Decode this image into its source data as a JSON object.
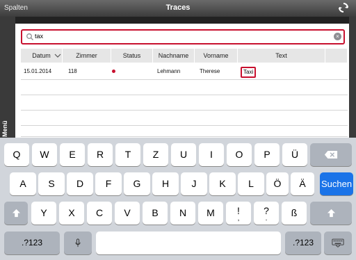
{
  "topbar": {
    "left_label": "Spalten",
    "title": "Traces",
    "right_icon": "refresh-icon"
  },
  "sidebar": {
    "menu_label": "Menü"
  },
  "search": {
    "value": "tax",
    "placeholder": ""
  },
  "table": {
    "columns": [
      "Datum",
      "Zimmer",
      "Status",
      "Nachname",
      "Vorname",
      "Text"
    ],
    "rows": [
      {
        "datum": "15.01.2014",
        "zimmer": "118",
        "status": "red-dot",
        "nachname": "Lehmann",
        "vorname": "Therese",
        "text": "Taxi"
      }
    ]
  },
  "keyboard": {
    "row1": [
      "Q",
      "W",
      "E",
      "R",
      "T",
      "Z",
      "U",
      "I",
      "O",
      "P",
      "Ü"
    ],
    "row2": [
      "A",
      "S",
      "D",
      "F",
      "G",
      "H",
      "J",
      "K",
      "L",
      "Ö",
      "Ä"
    ],
    "row3": [
      "Y",
      "X",
      "C",
      "V",
      "B",
      "N",
      "M",
      "!",
      "?",
      "ß"
    ],
    "row3_sub": [
      ",",
      "."
    ],
    "search_key": "Suchen",
    "numbers_key": ".?123",
    "colors": {
      "accent": "#c8102e",
      "search_key": "#1a73e8"
    }
  }
}
